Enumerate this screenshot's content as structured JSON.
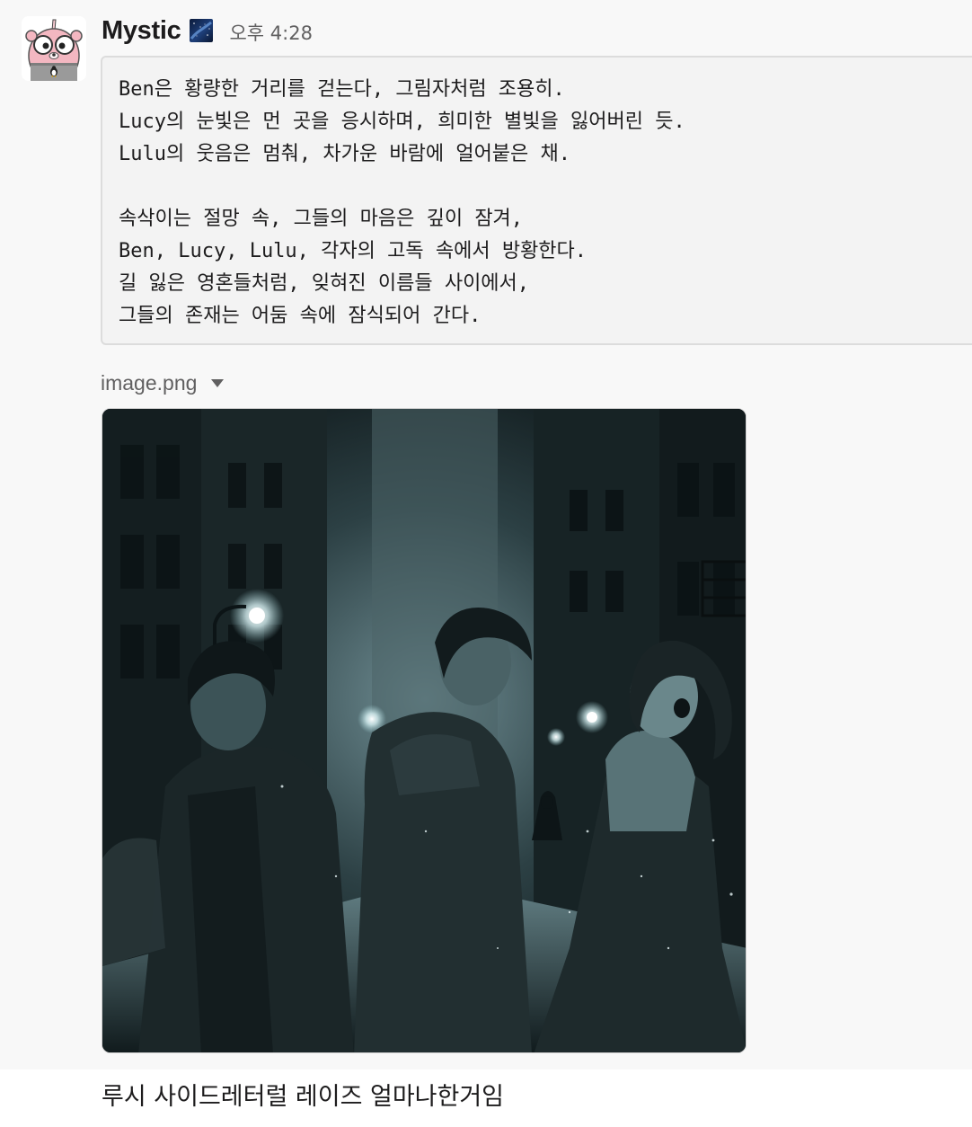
{
  "message": {
    "username": "Mystic",
    "status_emoji_icon": "night-sky-icon",
    "timestamp": "오후 4:28",
    "code_lines": [
      "Ben은 황량한 거리를 걷는다, 그림자처럼 조용히.",
      "Lucy의 눈빛은 먼 곳을 응시하며, 희미한 별빛을 잃어버린 듯.",
      "Lulu의 웃음은 멈춰, 차가운 바람에 얼어붙은 채.",
      "",
      "속삭이는 절망 속, 그들의 마음은 깊이 잠겨,",
      "Ben, Lucy, Lulu, 각자의 고독 속에서 방황한다.",
      "길 잃은 영혼들처럼, 잊혀진 이름들 사이에서,",
      "그들의 존재는 어둠 속에 잠식되어 간다."
    ],
    "attachment": {
      "file_name": "image.png",
      "caret_icon": "caret-down-icon"
    }
  },
  "next_message": {
    "text": "루시 사이드레터럴 레이즈 얼마나한거임"
  },
  "colors": {
    "highlight_bg": "#f8f8f8",
    "code_bg": "#f3f3f3",
    "code_border": "#dcdcdc",
    "muted_text": "#616061",
    "text": "#1d1c1d"
  }
}
